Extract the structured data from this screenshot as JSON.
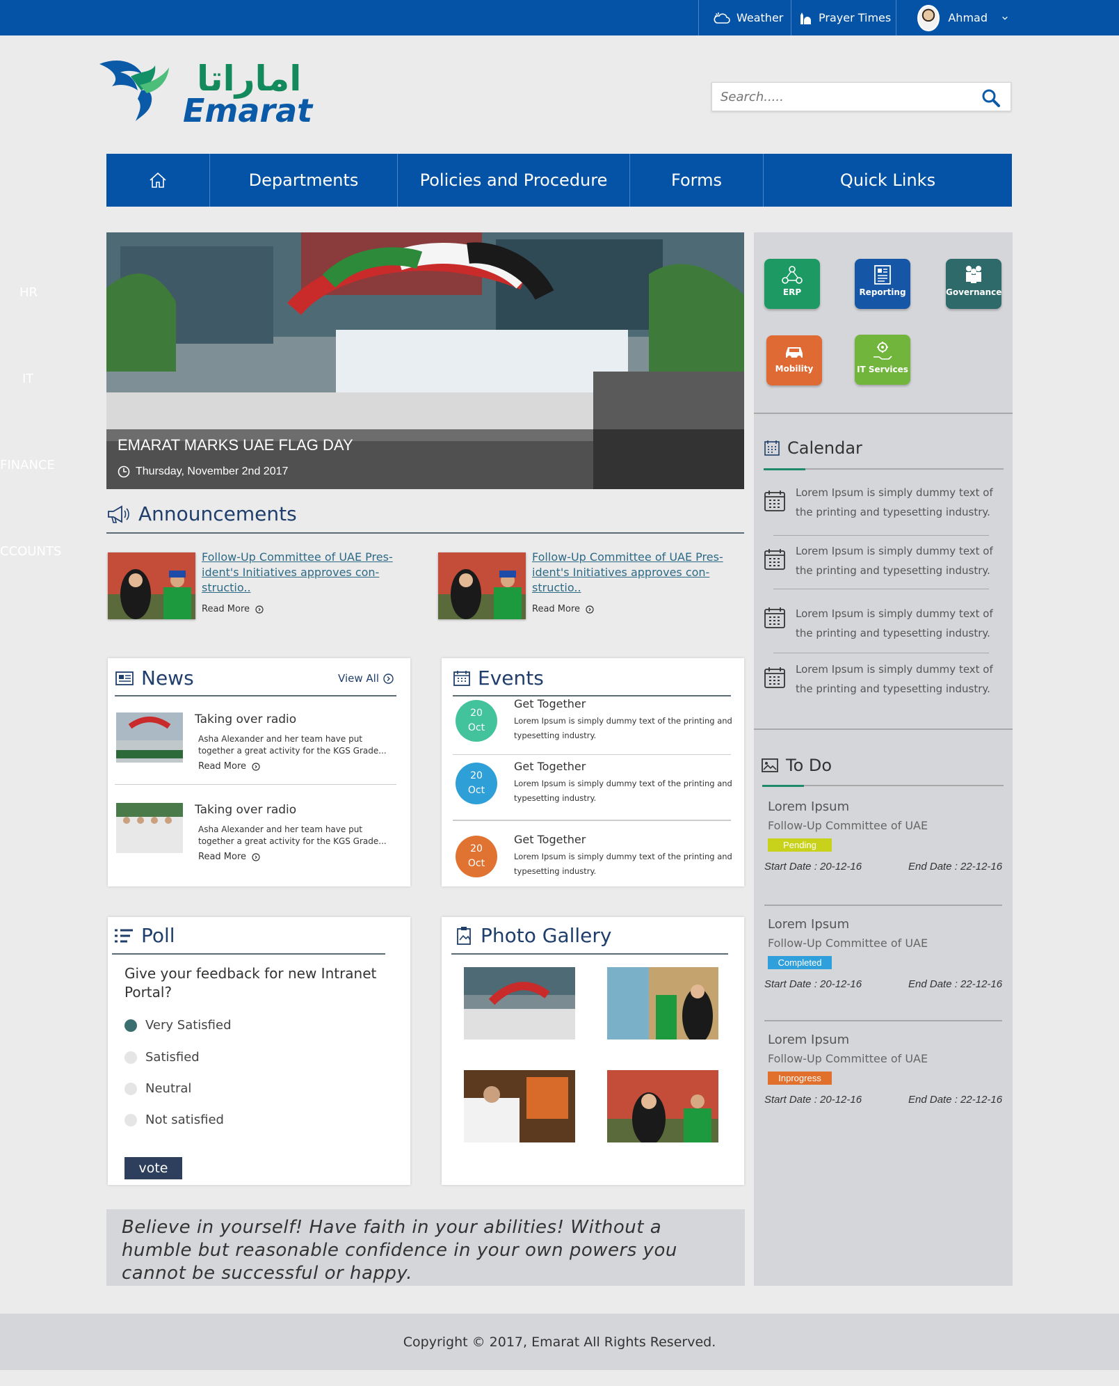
{
  "topbar": {
    "weather": "Weather",
    "prayer": "Prayer Times",
    "user": "Ahmad"
  },
  "logo": {
    "arabic": "اماراتا",
    "english": "Emarat"
  },
  "search": {
    "placeholder": "Search....."
  },
  "nav": {
    "home": "home-icon",
    "items": [
      "Departments",
      "Policies and Procedure",
      "Forms",
      "Quick Links"
    ]
  },
  "side_nav": [
    "HR",
    "IT",
    "FINANCE",
    "ACCOUNTS"
  ],
  "hero": {
    "title": "EMARAT MARKS UAE FLAG DAY",
    "date": "Thursday, November 2nd 2017"
  },
  "announcements": {
    "title": "Announcements",
    "items": [
      {
        "text": "Follow-Up Committee of UAE Pres-ident's Initiatives approves con-structio..",
        "read_more": "Read More"
      },
      {
        "text": "Follow-Up Committee of UAE Pres-ident's Initiatives approves con-structio..",
        "read_more": "Read More"
      }
    ]
  },
  "news": {
    "title": "News",
    "view_all": "View All",
    "items": [
      {
        "title": "Taking over radio",
        "text": "Asha Alexander and her team have put together a great activity for the KGS Grade...",
        "read_more": "Read More"
      },
      {
        "title": "Taking over radio",
        "text": "Asha Alexander and her team have put together a great activity for the KGS Grade...",
        "read_more": "Read More"
      }
    ]
  },
  "events": {
    "title": "Events",
    "items": [
      {
        "day": "20",
        "month": "Oct",
        "title": "Get Together",
        "text": "Lorem Ipsum is simply dummy text of the printing and typesetting industry.",
        "color": "#43c39c"
      },
      {
        "day": "20",
        "month": "Oct",
        "title": "Get Together",
        "text": "Lorem Ipsum is simply dummy text of the printing and typesetting industry.",
        "color": "#2f9fd8"
      },
      {
        "day": "20",
        "month": "Oct",
        "title": "Get Together",
        "text": "Lorem Ipsum is simply dummy text of the printing and typesetting industry.",
        "color": "#e07331"
      }
    ]
  },
  "poll": {
    "title": "Poll",
    "question": "Give your feedback for new Intranet Portal?",
    "options": [
      "Very Satisfied",
      "Satisfied",
      "Neutral",
      "Not satisfied"
    ],
    "selected": "Very Satisfied",
    "vote": "vote"
  },
  "gallery": {
    "title": "Photo Gallery"
  },
  "quote": "Believe in yourself! Have faith in your abilities! Without a humble but reasonable confidence in your own powers you cannot be successful or happy.",
  "footer": "Copyright © 2017, Emarat All Rights Reserved.",
  "apps": [
    {
      "label": "ERP",
      "color": "#1d9a63"
    },
    {
      "label": "Reporting",
      "color": "#1656a6"
    },
    {
      "label": "Governance",
      "color": "#2f6a6a"
    },
    {
      "label": "Mobility",
      "color": "#e06a34"
    },
    {
      "label": "IT Services",
      "color": "#72b53c"
    }
  ],
  "calendar": {
    "title": "Calendar",
    "items": [
      "Lorem Ipsum is simply dummy text of the printing and typesetting industry.",
      "Lorem Ipsum is simply dummy text of the printing and typesetting industry.",
      "Lorem Ipsum is simply dummy text of the printing and typesetting industry.",
      "Lorem Ipsum is simply dummy text of the printing and typesetting industry."
    ]
  },
  "todo": {
    "title": "To Do",
    "items": [
      {
        "title": "Lorem Ipsum",
        "subtitle": "Follow-Up Committee of UAE",
        "status": "Pending",
        "status_color": "#c8d21a",
        "start": "Start Date : 20-12-16",
        "end": "End Date : 22-12-16"
      },
      {
        "title": "Lorem Ipsum",
        "subtitle": "Follow-Up Committee of UAE",
        "status": "Completed",
        "status_color": "#2fa0db",
        "start": "Start Date : 20-12-16",
        "end": "End Date : 22-12-16"
      },
      {
        "title": "Lorem Ipsum",
        "subtitle": "Follow-Up Committee of UAE",
        "status": "Inprogress",
        "status_color": "#e0702c",
        "start": "Start Date : 20-12-16",
        "end": "End Date : 22-12-16"
      }
    ]
  }
}
